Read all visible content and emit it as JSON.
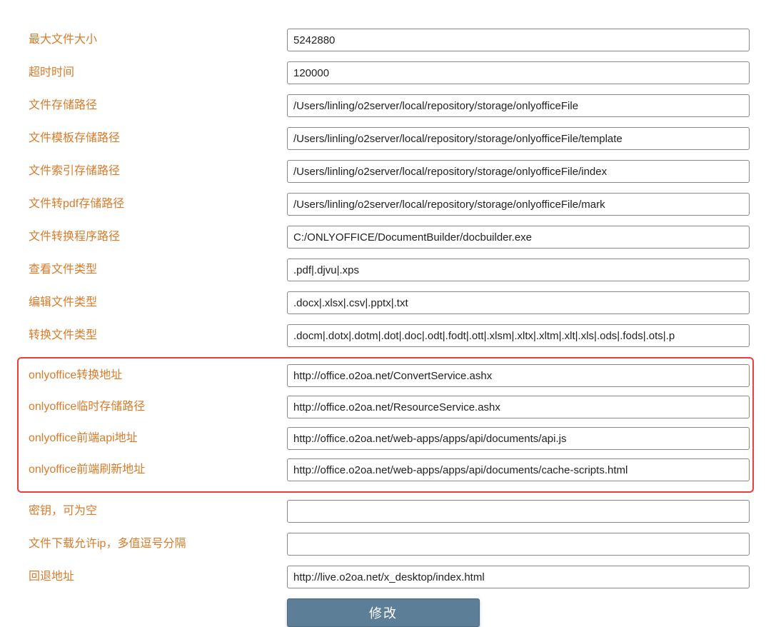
{
  "fields": {
    "max_file_size": {
      "label": "最大文件大小",
      "value": "5242880"
    },
    "timeout": {
      "label": "超时时间",
      "value": "120000"
    },
    "file_store_path": {
      "label": "文件存储路径",
      "value": "/Users/linling/o2server/local/repository/storage/onlyofficeFile"
    },
    "file_template_path": {
      "label": "文件模板存储路径",
      "value": "/Users/linling/o2server/local/repository/storage/onlyofficeFile/template"
    },
    "file_index_path": {
      "label": "文件索引存储路径",
      "value": "/Users/linling/o2server/local/repository/storage/onlyofficeFile/index"
    },
    "file_pdf_path": {
      "label": "文件转pdf存储路径",
      "value": "/Users/linling/o2server/local/repository/storage/onlyofficeFile/mark"
    },
    "file_convert_prog": {
      "label": "文件转换程序路径",
      "value": "C:/ONLYOFFICE/DocumentBuilder/docbuilder.exe"
    },
    "view_file_types": {
      "label": "查看文件类型",
      "value": ".pdf|.djvu|.xps"
    },
    "edit_file_types": {
      "label": "编辑文件类型",
      "value": ".docx|.xlsx|.csv|.pptx|.txt"
    },
    "convert_file_types": {
      "label": "转换文件类型",
      "value": ".docm|.dotx|.dotm|.dot|.doc|.odt|.fodt|.ott|.xlsm|.xltx|.xltm|.xlt|.xls|.ods|.fods|.ots|.p"
    },
    "oo_convert_url": {
      "label": "onlyoffice转换地址",
      "value": "http://office.o2oa.net/ConvertService.ashx"
    },
    "oo_temp_store": {
      "label": "onlyoffice临时存储路径",
      "value": "http://office.o2oa.net/ResourceService.ashx"
    },
    "oo_api_url": {
      "label": "onlyoffice前端api地址",
      "value": "http://office.o2oa.net/web-apps/apps/api/documents/api.js"
    },
    "oo_refresh_url": {
      "label": "onlyoffice前端刷新地址",
      "value": "http://office.o2oa.net/web-apps/apps/api/documents/cache-scripts.html"
    },
    "secret_key": {
      "label": "密钥，可为空",
      "value": ""
    },
    "download_ip": {
      "label": "文件下载允许ip，多值逗号分隔",
      "value": ""
    },
    "fallback_url": {
      "label": "回退地址",
      "value": "http://live.o2oa.net/x_desktop/index.html"
    }
  },
  "button": {
    "submit_label": "修改"
  }
}
